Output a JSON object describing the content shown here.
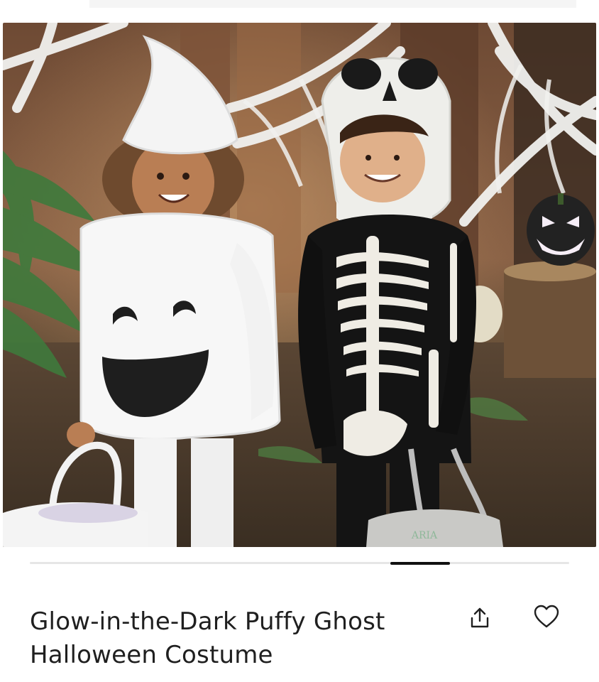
{
  "product": {
    "title_line1": "Glow-in-the-Dark Puffy Ghost",
    "title_line2": "Halloween Costume",
    "bag_monogram": "ARIA"
  },
  "carousel": {
    "active_slide": 6,
    "total_slides": 9
  },
  "actions": {
    "share_icon": "share-icon",
    "favorite_icon": "heart-icon"
  },
  "colors": {
    "accent": "#111111",
    "text": "#1f1f1f"
  }
}
